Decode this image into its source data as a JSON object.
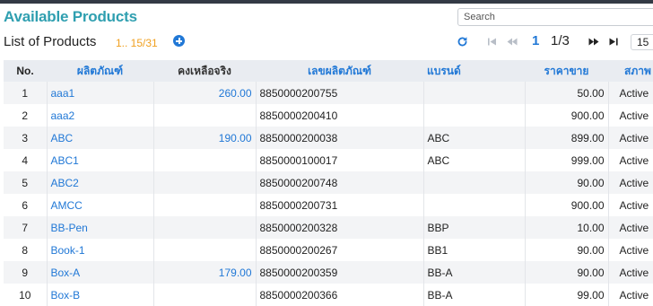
{
  "header": {
    "title": "Available Products",
    "subtitle": "List of Products",
    "count": "1.. 15/31"
  },
  "search": {
    "placeholder": "Search",
    "value": ""
  },
  "pager": {
    "current": "1",
    "total": "1/3",
    "page_size": "15"
  },
  "columns": {
    "no": "No.",
    "name": "ผลิตภัณฑ์",
    "stock": "คงเหลือจริง",
    "code": "เลขผลิตภัณฑ์",
    "brand": "แบรนด์",
    "price": "ราคาขาย",
    "status": "สภาพ"
  },
  "rows": [
    {
      "no": "1",
      "name": "aaa1",
      "stock": "260.00",
      "code": "8850000200755",
      "brand": "",
      "price": "50.00",
      "status": "Active"
    },
    {
      "no": "2",
      "name": "aaa2",
      "stock": "",
      "code": "8850000200410",
      "brand": "",
      "price": "900.00",
      "status": "Active"
    },
    {
      "no": "3",
      "name": "ABC",
      "stock": "190.00",
      "code": "8850000200038",
      "brand": "ABC",
      "price": "899.00",
      "status": "Active"
    },
    {
      "no": "4",
      "name": "ABC1",
      "stock": "",
      "code": "8850000100017",
      "brand": "ABC",
      "price": "999.00",
      "status": "Active"
    },
    {
      "no": "5",
      "name": "ABC2",
      "stock": "",
      "code": "8850000200748",
      "brand": "",
      "price": "90.00",
      "status": "Active"
    },
    {
      "no": "6",
      "name": "AMCC",
      "stock": "",
      "code": "8850000200731",
      "brand": "",
      "price": "900.00",
      "status": "Active"
    },
    {
      "no": "7",
      "name": "BB-Pen",
      "stock": "",
      "code": "8850000200328",
      "brand": "BBP",
      "price": "10.00",
      "status": "Active"
    },
    {
      "no": "8",
      "name": "Book-1",
      "stock": "",
      "code": "8850000200267",
      "brand": "BB1",
      "price": "90.00",
      "status": "Active"
    },
    {
      "no": "9",
      "name": "Box-A",
      "stock": "179.00",
      "code": "8850000200359",
      "brand": "BB-A",
      "price": "90.00",
      "status": "Active"
    },
    {
      "no": "10",
      "name": "Box-B",
      "stock": "",
      "code": "8850000200366",
      "brand": "BB-A",
      "price": "99.00",
      "status": "Active"
    }
  ],
  "icons": {
    "add": "plus-circle-icon",
    "refresh": "refresh-icon",
    "first": "first-page-icon",
    "prev": "prev-page-icon",
    "next": "next-page-icon",
    "last": "last-page-icon"
  },
  "colors": {
    "accent": "#2178d6",
    "title": "#2f9fb0",
    "count": "#f0a020",
    "header_bg": "#e9ecf1"
  }
}
